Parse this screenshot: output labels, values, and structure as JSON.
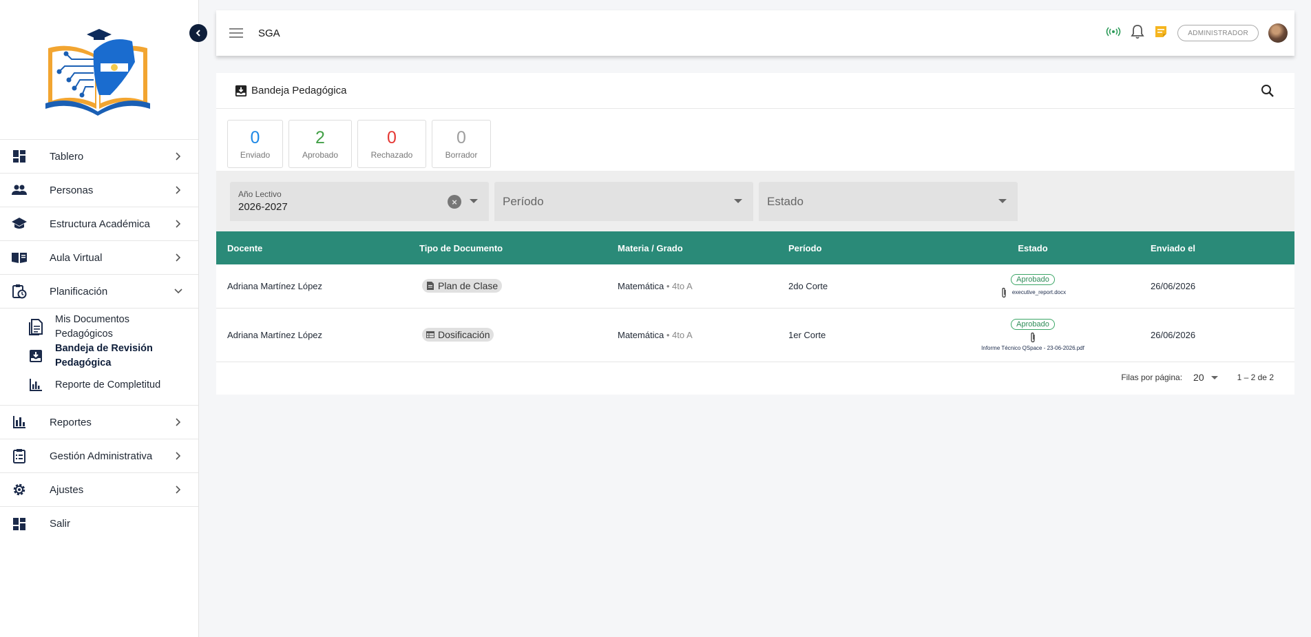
{
  "header": {
    "title": "SGA",
    "role": "ADMINISTRADOR"
  },
  "sidebar": {
    "items": [
      {
        "label": "Tablero",
        "icon": "dashboard-icon"
      },
      {
        "label": "Personas",
        "icon": "people-icon"
      },
      {
        "label": "Estructura Académica",
        "icon": "school-icon"
      },
      {
        "label": "Aula Virtual",
        "icon": "book-icon"
      },
      {
        "label": "Planificación",
        "icon": "clipboard-clock-icon",
        "expanded": true
      },
      {
        "label": "Reportes",
        "icon": "bar-chart-icon"
      },
      {
        "label": "Gestión Administrativa",
        "icon": "clipboard-list-icon"
      },
      {
        "label": "Ajustes",
        "icon": "gear-icon"
      },
      {
        "label": "Salir",
        "icon": "dashboard-icon"
      }
    ],
    "sub_items": [
      {
        "label": "Mis Documentos Pedagógicos",
        "icon": "document-icon"
      },
      {
        "label": "Bandeja de Revisión Pedagógica",
        "icon": "inbox-icon",
        "active": true
      },
      {
        "label": "Reporte de Completitud",
        "icon": "chart-icon"
      }
    ]
  },
  "panel": {
    "title": "Bandeja Pedagógica"
  },
  "stats": [
    {
      "value": "0",
      "label": "Enviado",
      "color": "#1e88e5"
    },
    {
      "value": "2",
      "label": "Aprobado",
      "color": "#43a047"
    },
    {
      "value": "0",
      "label": "Rechazado",
      "color": "#e53935"
    },
    {
      "value": "0",
      "label": "Borrador",
      "color": "#9e9e9e"
    }
  ],
  "filters": {
    "year_label": "Año Lectivo",
    "year_value": "2026-2027",
    "period_placeholder": "Período",
    "status_placeholder": "Estado"
  },
  "table": {
    "columns": [
      "Docente",
      "Tipo de Documento",
      "Materia / Grado",
      "Período",
      "Estado",
      "Enviado el"
    ],
    "rows": [
      {
        "docente": "Adriana Martínez López",
        "tipo": "Plan de Clase",
        "materia": "Matemática",
        "grado": "• 4to A",
        "periodo": "2do Corte",
        "estado": "Aprobado",
        "archivo": "executive_report.docx",
        "fecha": "26/06/2026"
      },
      {
        "docente": "Adriana Martínez López",
        "tipo": "Dosificación",
        "materia": "Matemática",
        "grado": "• 4to A",
        "periodo": "1er Corte",
        "estado": "Aprobado",
        "archivo": "Informe Técnico QSpace - 23-06-2026.pdf",
        "fecha": "26/06/2026"
      }
    ]
  },
  "pagination": {
    "rows_label": "Filas por página:",
    "rows_value": "20",
    "range": "1 – 2 de 2"
  }
}
